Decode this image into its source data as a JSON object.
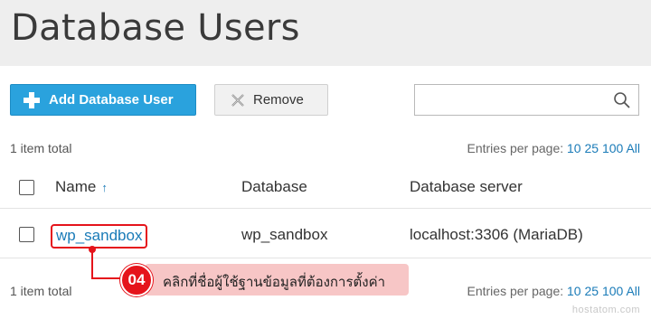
{
  "page": {
    "title": "Database Users"
  },
  "toolbar": {
    "add_label": "Add Database User",
    "remove_label": "Remove",
    "search_value": "",
    "search_placeholder": ""
  },
  "summary": {
    "total_top": "1 item total",
    "total_bottom": "1 item total",
    "entries_label": "Entries per page:",
    "entries_options": [
      "10",
      "25",
      "100",
      "All"
    ]
  },
  "table": {
    "columns": [
      "Name",
      "Database",
      "Database server"
    ],
    "sort_indicator": "↑",
    "rows": [
      {
        "name": "wp_sandbox",
        "database": "wp_sandbox",
        "server": "localhost:3306 (MariaDB)"
      }
    ]
  },
  "annotation": {
    "step": "04",
    "text": "คลิกที่ชื่อผู้ใช้ฐานข้อมูลที่ต้องการตั้งค่า"
  },
  "watermark": "hostatom.com",
  "colors": {
    "accent": "#2aa2dd",
    "link": "#1a7bb8",
    "highlight": "#e5141b",
    "callout_bg": "#f7c6c6",
    "header_bg": "#eeeeee"
  }
}
